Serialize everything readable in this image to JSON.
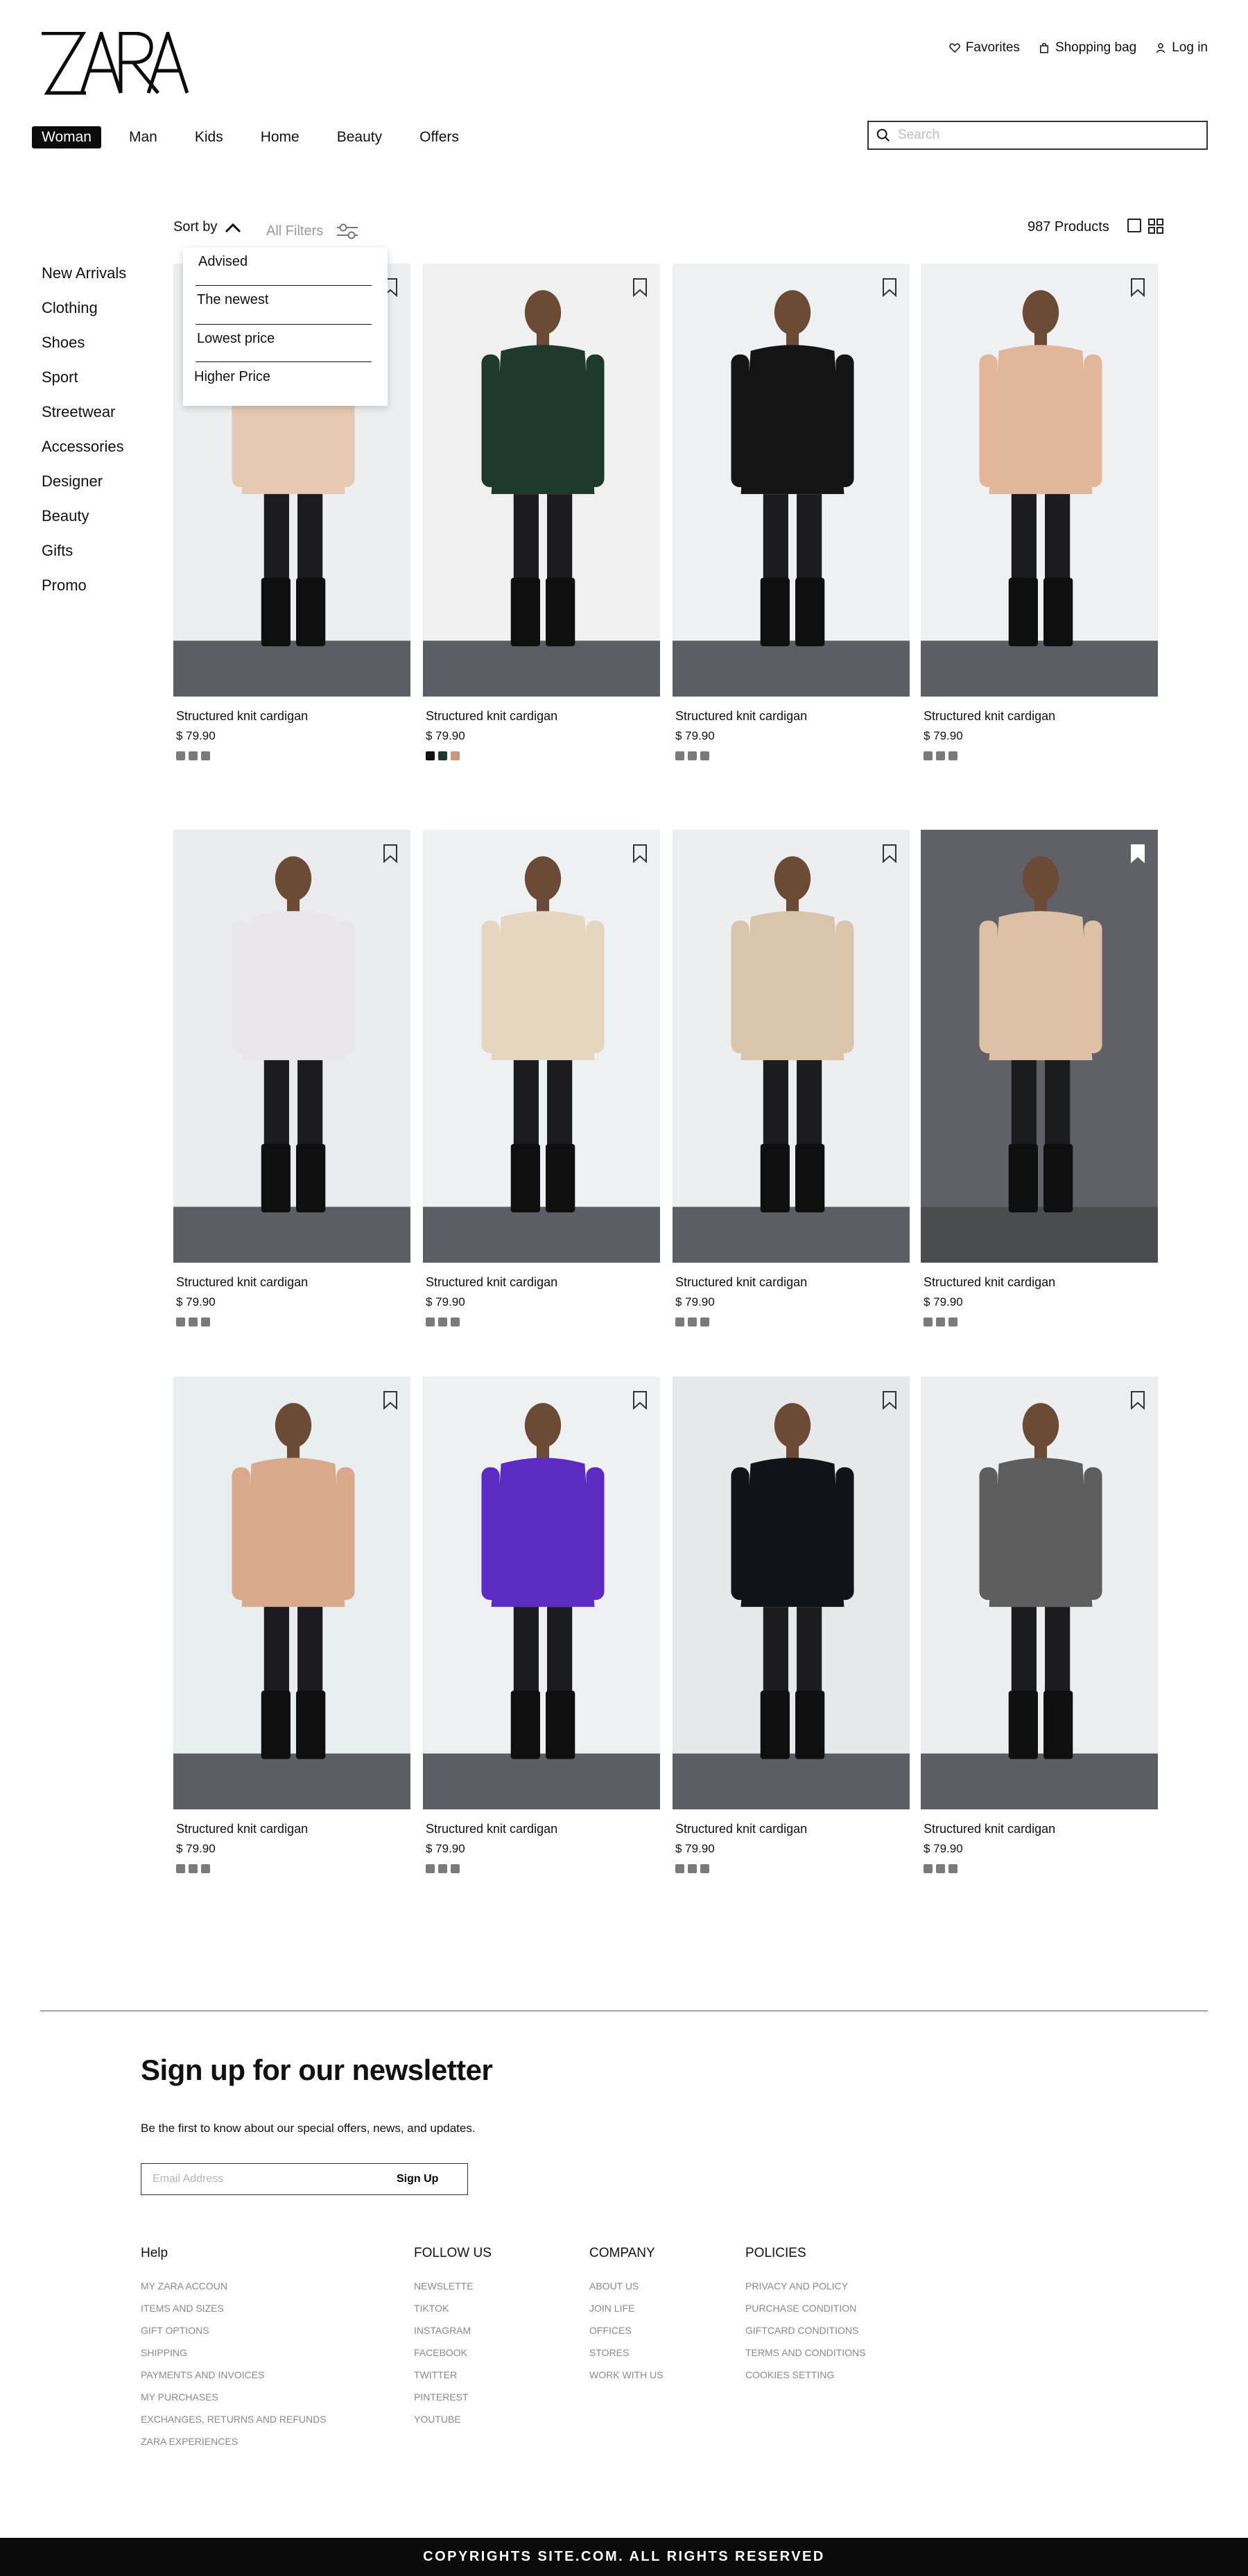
{
  "brand": {
    "logo": "ZARA"
  },
  "header": {
    "favorites": "Favorites",
    "bag": "Shopping bag",
    "login": "Log in"
  },
  "nav": {
    "items": [
      "Woman",
      "Man",
      "Kids",
      "Home",
      "Beauty",
      "Offers"
    ],
    "active": "Woman"
  },
  "search": {
    "placeholder": "Search",
    "value": ""
  },
  "toolbar": {
    "sort_label": "Sort by",
    "filters_label": "All Filters",
    "count": "987 Products"
  },
  "sort_menu": {
    "open": true,
    "options": [
      "Advised",
      "The newest",
      "Lowest price",
      "Higher Price"
    ]
  },
  "sidebar": {
    "items": [
      "New Arrivals",
      "Clothing",
      "Shoes",
      "Sport",
      "Streetwear",
      "Accessories",
      "Designer",
      "Beauty",
      "Gifts",
      "Promo"
    ]
  },
  "products": [
    {
      "name": "Structured knit cardigan",
      "price": "$ 79.90",
      "swatches": [
        "#7a7a7a",
        "#7a7a7a",
        "#7a7a7a"
      ],
      "bg": "#eceef0",
      "garment": "#e6c9b3",
      "saved": false
    },
    {
      "name": "Structured knit cardigan",
      "price": "$ 79.90",
      "swatches": [
        "#111111",
        "#1b3a2d",
        "#c89a7c"
      ],
      "bg": "#f0f0f0",
      "garment": "#1e3a2c",
      "saved": false
    },
    {
      "name": "Structured knit cardigan",
      "price": "$ 79.90",
      "swatches": [
        "#7a7a7a",
        "#7a7a7a",
        "#7a7a7a"
      ],
      "bg": "#eef0f2",
      "garment": "#141414",
      "saved": false
    },
    {
      "name": "Structured knit cardigan",
      "price": "$ 79.90",
      "swatches": [
        "#7a7a7a",
        "#7a7a7a",
        "#7a7a7a"
      ],
      "bg": "#eef0f2",
      "garment": "#e2b69a",
      "saved": false
    },
    {
      "name": "Structured knit cardigan",
      "price": "$ 79.90",
      "swatches": [
        "#7a7a7a",
        "#7a7a7a",
        "#7a7a7a"
      ],
      "bg": "#e9ebee",
      "garment": "#e9e7ea",
      "saved": false
    },
    {
      "name": "Structured knit cardigan",
      "price": "$ 79.90",
      "swatches": [
        "#7a7a7a",
        "#7a7a7a",
        "#7a7a7a"
      ],
      "bg": "#eef1f4",
      "garment": "#e5d6bf",
      "saved": false
    },
    {
      "name": "Structured knit cardigan",
      "price": "$ 79.90",
      "swatches": [
        "#7a7a7a",
        "#7a7a7a",
        "#7a7a7a"
      ],
      "bg": "#eceeef",
      "garment": "#d9c5ac",
      "saved": false
    },
    {
      "name": "Structured knit cardigan",
      "price": "$ 79.90",
      "swatches": [
        "#7a7a7a",
        "#7a7a7a",
        "#7a7a7a"
      ],
      "bg": "#5f6166",
      "garment": "#dcc1a6",
      "saved": true
    },
    {
      "name": "Structured knit cardigan",
      "price": "$ 79.90",
      "swatches": [
        "#7a7a7a",
        "#7a7a7a",
        "#7a7a7a"
      ],
      "bg": "#e9eef0",
      "garment": "#d8a98a",
      "saved": false
    },
    {
      "name": "Structured knit cardigan",
      "price": "$ 79.90",
      "swatches": [
        "#7a7a7a",
        "#7a7a7a",
        "#7a7a7a"
      ],
      "bg": "#eef0f2",
      "garment": "#5b2bc4",
      "saved": false
    },
    {
      "name": "Structured knit cardigan",
      "price": "$ 79.90",
      "swatches": [
        "#7a7a7a",
        "#7a7a7a",
        "#7a7a7a"
      ],
      "bg": "#e6e8ea",
      "garment": "#101418",
      "saved": false
    },
    {
      "name": "Structured knit cardigan",
      "price": "$ 79.90",
      "swatches": [
        "#7a7a7a",
        "#7a7a7a",
        "#7a7a7a"
      ],
      "bg": "#eceeef",
      "garment": "#5e5e5e",
      "saved": false
    }
  ],
  "newsletter": {
    "title": "Sign up for our newsletter",
    "subtitle": "Be the first to know about our special offers, news, and updates.",
    "placeholder": "Email Address",
    "button": "Sign Up"
  },
  "footer": {
    "columns": [
      {
        "heading": "Help",
        "links": [
          "MY ZARA ACCOUN",
          "ITEMS AND SIZES",
          "GIFT OPTIONS",
          "SHIPPING",
          "PAYMENTS AND INVOICES",
          "MY PURCHASES",
          "EXCHANGES, RETURNS AND REFUNDS",
          "ZARA EXPERIENCES"
        ]
      },
      {
        "heading": "FOLLOW US",
        "links": [
          "NEWSLETTE",
          "TIKTOK",
          "INSTAGRAM",
          "FACEBOOK",
          "TWITTER",
          "PINTEREST",
          "YOUTUBE"
        ]
      },
      {
        "heading": "COMPANY",
        "links": [
          "ABOUT US",
          "JOIN LIFE",
          "OFFICES",
          "STORES",
          "WORK WITH US"
        ]
      },
      {
        "heading": "POLICIES",
        "links": [
          "PRIVACY AND POLICY",
          "PURCHASE CONDITION",
          "GIFTCARD CONDITIONS",
          "TERMS AND CONDITIONS",
          "COOKIES SETTING"
        ]
      }
    ],
    "copyright": "COPYRIGHTS SITE.COM. ALL RIGHTS RESERVED"
  }
}
